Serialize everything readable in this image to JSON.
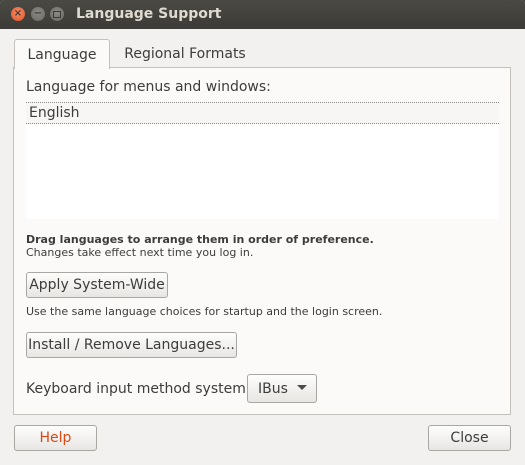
{
  "window": {
    "title": "Language Support",
    "controls": [
      "close-icon",
      "minimize-icon",
      "maximize-icon"
    ]
  },
  "tabs": [
    {
      "label": "Language",
      "active": true
    },
    {
      "label": "Regional Formats",
      "active": false
    }
  ],
  "language": {
    "heading": "Language for menus and windows:",
    "items": [
      "English"
    ],
    "hint_bold": "Drag languages to arrange them in order of preference.",
    "hint": "Changes take effect next time you log in.",
    "apply_button": "Apply System-Wide",
    "apply_desc": "Use the same language choices for startup and the login screen.",
    "install_button": "Install / Remove Languages...",
    "keyboard_label": "Keyboard input method system:",
    "keyboard_value": "IBus"
  },
  "footer": {
    "help": "Help",
    "close": "Close"
  },
  "colors": {
    "titlebar": "#3c3b37",
    "close_button": "#e95a2a",
    "help_text": "#dd4814",
    "window_bg": "#f2f1f0"
  }
}
